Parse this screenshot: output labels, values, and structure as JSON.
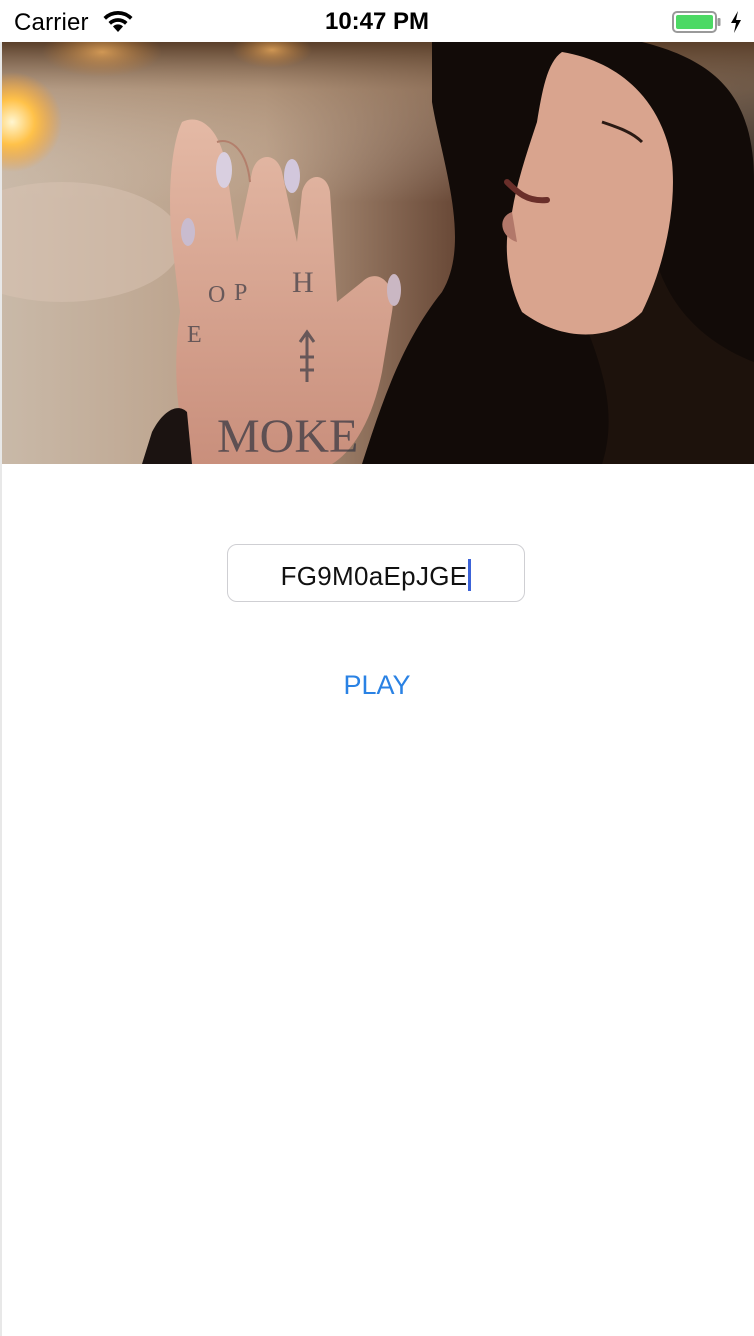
{
  "status_bar": {
    "carrier": "Carrier",
    "time": "10:47 PM",
    "battery_color": "#4cd964",
    "icons": [
      "wifi-icon",
      "battery-icon",
      "charging-bolt-icon"
    ]
  },
  "hero": {
    "content": "video-frame"
  },
  "video_id_field": {
    "value": "FG9M0aEpJGE"
  },
  "play_button": {
    "label": "PLAY",
    "color": "#2a82e4"
  }
}
